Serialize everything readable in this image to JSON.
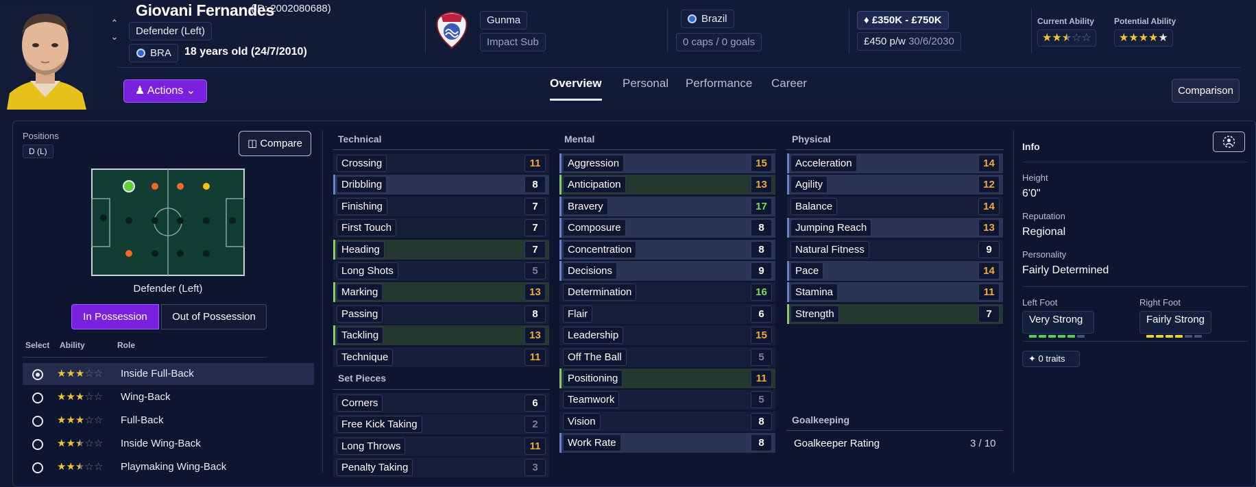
{
  "player": {
    "name": "Giovani Fernandes",
    "id_text": "(ID: 2002080688)",
    "position": "Defender (Left)",
    "nation_code": "BRA",
    "age_text": "18 years old (24/7/2010)"
  },
  "club": {
    "name": "Gunma",
    "squad_role": "Impact Sub"
  },
  "international": {
    "country": "Brazil",
    "caps_goals": "0 caps / 0 goals"
  },
  "contract": {
    "value_range": "£350K - £750K",
    "wage": "£450 p/w",
    "expiry": "30/6/2030"
  },
  "ability": {
    "current_label": "Current Ability",
    "current_stars": 2.5,
    "potential_label": "Potential Ability",
    "potential_stars": 5
  },
  "actions_label": "Actions",
  "tabs": [
    {
      "label": "Overview",
      "active": true
    },
    {
      "label": "Personal"
    },
    {
      "label": "Performance"
    },
    {
      "label": "Career"
    }
  ],
  "comparison_label": "Comparison",
  "positions": {
    "label": "Positions",
    "chip": "D (L)",
    "compare_label": "Compare",
    "role_title": "Defender (Left)",
    "in_possession": "In Possession",
    "out_possession": "Out of Possession"
  },
  "roles": {
    "headers": {
      "select": "Select",
      "ability": "Ability",
      "role": "Role"
    },
    "items": [
      {
        "name": "Inside Full-Back",
        "stars": 3,
        "selected": true
      },
      {
        "name": "Wing-Back",
        "stars": 3
      },
      {
        "name": "Full-Back",
        "stars": 3
      },
      {
        "name": "Inside Wing-Back",
        "stars": 2.5
      },
      {
        "name": "Playmaking Wing-Back",
        "stars": 2.5
      }
    ]
  },
  "technical": {
    "title": "Technical",
    "items": [
      {
        "name": "Crossing",
        "value": 11
      },
      {
        "name": "Dribbling",
        "value": 8,
        "hl": "blue"
      },
      {
        "name": "Finishing",
        "value": 7
      },
      {
        "name": "First Touch",
        "value": 7
      },
      {
        "name": "Heading",
        "value": 7,
        "hl": "green"
      },
      {
        "name": "Long Shots",
        "value": 5
      },
      {
        "name": "Marking",
        "value": 13,
        "hl": "green"
      },
      {
        "name": "Passing",
        "value": 8
      },
      {
        "name": "Tackling",
        "value": 13,
        "hl": "green"
      },
      {
        "name": "Technique",
        "value": 11
      }
    ]
  },
  "set_pieces": {
    "title": "Set Pieces",
    "items": [
      {
        "name": "Corners",
        "value": 6
      },
      {
        "name": "Free Kick Taking",
        "value": 2
      },
      {
        "name": "Long Throws",
        "value": 11
      },
      {
        "name": "Penalty Taking",
        "value": 3
      }
    ]
  },
  "mental": {
    "title": "Mental",
    "items": [
      {
        "name": "Aggression",
        "value": 15,
        "hl": "blue"
      },
      {
        "name": "Anticipation",
        "value": 13,
        "hl": "green"
      },
      {
        "name": "Bravery",
        "value": 17,
        "hl": "blue"
      },
      {
        "name": "Composure",
        "value": 8,
        "hl": "blue"
      },
      {
        "name": "Concentration",
        "value": 8,
        "hl": "blue"
      },
      {
        "name": "Decisions",
        "value": 9,
        "hl": "blue"
      },
      {
        "name": "Determination",
        "value": 16
      },
      {
        "name": "Flair",
        "value": 6
      },
      {
        "name": "Leadership",
        "value": 15
      },
      {
        "name": "Off The Ball",
        "value": 5
      },
      {
        "name": "Positioning",
        "value": 11,
        "hl": "green"
      },
      {
        "name": "Teamwork",
        "value": 5
      },
      {
        "name": "Vision",
        "value": 8
      },
      {
        "name": "Work Rate",
        "value": 8,
        "hl": "blue"
      }
    ]
  },
  "physical": {
    "title": "Physical",
    "items": [
      {
        "name": "Acceleration",
        "value": 14,
        "hl": "blue"
      },
      {
        "name": "Agility",
        "value": 12,
        "hl": "blue"
      },
      {
        "name": "Balance",
        "value": 14
      },
      {
        "name": "Jumping Reach",
        "value": 13,
        "hl": "blue"
      },
      {
        "name": "Natural Fitness",
        "value": 9
      },
      {
        "name": "Pace",
        "value": 14,
        "hl": "blue"
      },
      {
        "name": "Stamina",
        "value": 11,
        "hl": "blue"
      },
      {
        "name": "Strength",
        "value": 7,
        "hl": "green"
      }
    ]
  },
  "goalkeeping": {
    "title": "Goalkeeping",
    "label": "Goalkeeper Rating",
    "value": "3 / 10"
  },
  "info": {
    "title": "Info",
    "height_label": "Height",
    "height": "6'0\"",
    "reputation_label": "Reputation",
    "reputation": "Regional",
    "personality_label": "Personality",
    "personality": "Fairly Determined",
    "left_foot_label": "Left Foot",
    "left_foot": "Very Strong",
    "left_foot_level": 5,
    "right_foot_label": "Right Foot",
    "right_foot": "Fairly Strong",
    "right_foot_level": 4,
    "traits_label": "0 traits"
  },
  "colors": {
    "accent": "#7a21e0",
    "star": "#f1c232",
    "attr_orange": "#f2a93b",
    "attr_green": "#7ed957",
    "attr_grey": "#7a829c",
    "foot_green": "#4fd24f",
    "foot_yellow": "#e6d81e"
  }
}
